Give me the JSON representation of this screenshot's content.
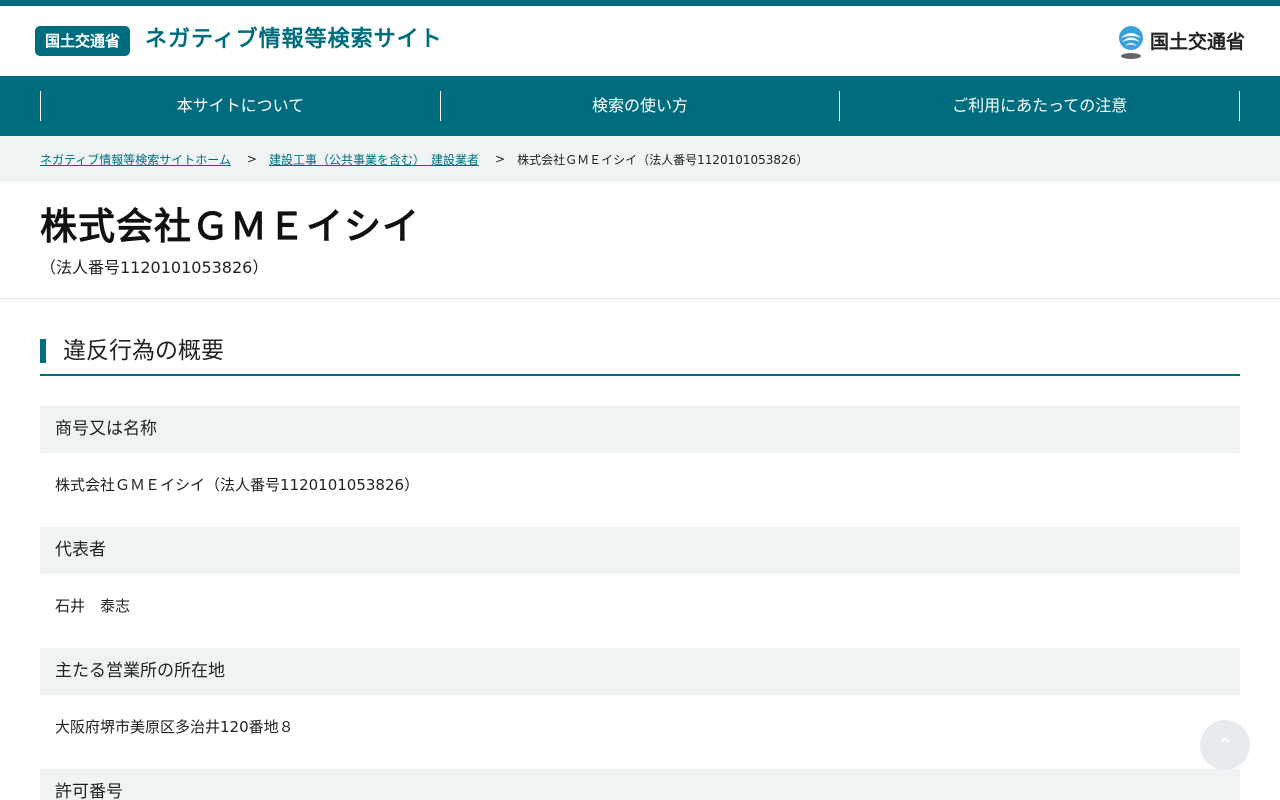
{
  "header": {
    "org_badge": "国土交通省",
    "site_title": "ネガティブ情報等検索サイト",
    "logo_text": "国土交通省",
    "brand_color": "#006d7f"
  },
  "gnav": [
    {
      "label": "本サイトについて"
    },
    {
      "label": "検索の使い方"
    },
    {
      "label": "ご利用にあたっての注意"
    }
  ],
  "breadcrumb": {
    "home": "ネガティブ情報等検索サイトホーム",
    "category": "建設工事（公共事業を含む）　建設業者",
    "current": "株式会社ＧＭＥイシイ（法人番号1120101053826）",
    "separator": ">"
  },
  "page": {
    "title": "株式会社ＧＭＥイシイ",
    "corp_number": "（法人番号1120101053826）"
  },
  "section": {
    "heading": "違反行為の概要",
    "items": [
      {
        "label": "商号又は名称",
        "value": "株式会社ＧＭＥイシイ（法人番号1120101053826）"
      },
      {
        "label": "代表者",
        "value": "石井　泰志"
      },
      {
        "label": "主たる営業所の所在地",
        "value": "大阪府堺市美原区多治井120番地８"
      },
      {
        "label": "許可番号",
        "value": ""
      }
    ]
  },
  "back_to_top_icon": "arrow-up-icon"
}
